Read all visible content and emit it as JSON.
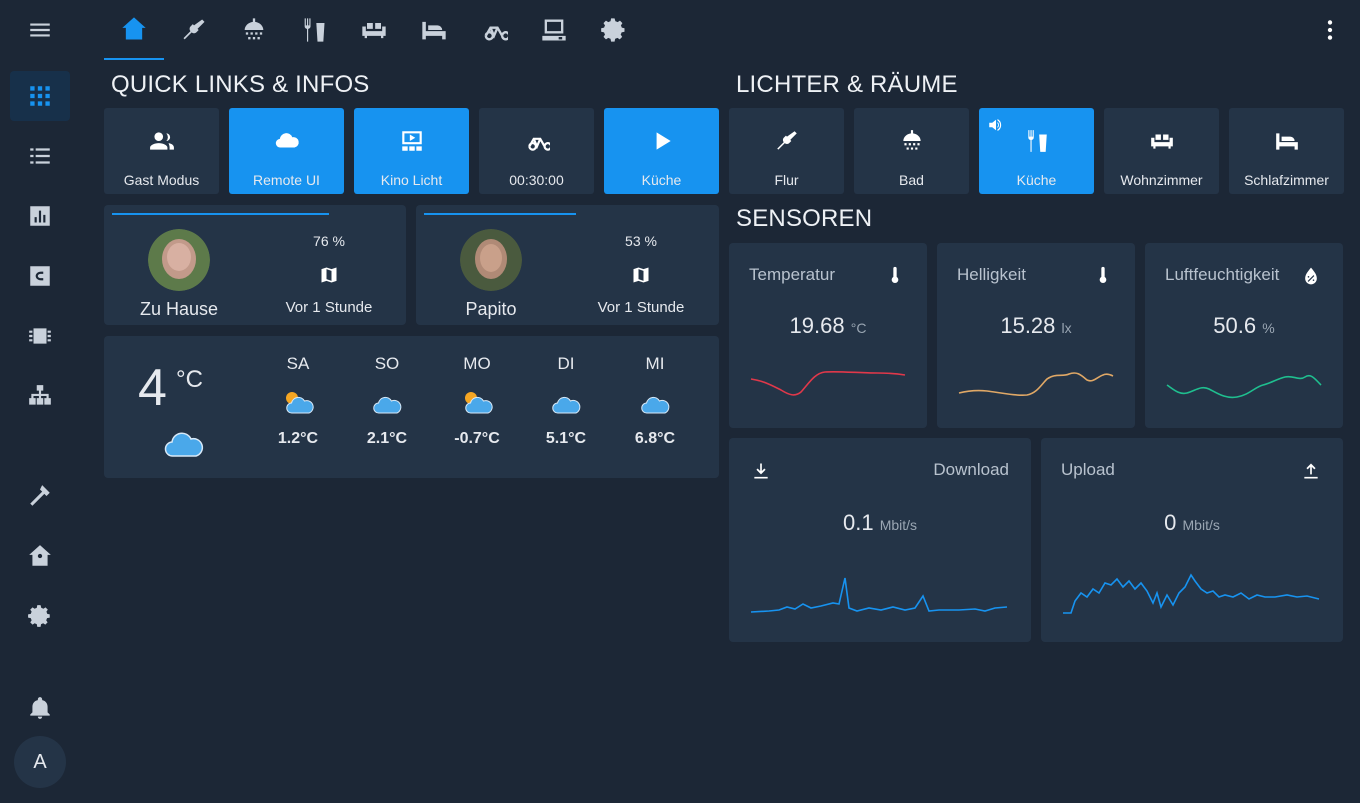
{
  "sidebar": {
    "items": [
      {
        "icon": "grid-icon"
      },
      {
        "icon": "list-icon"
      },
      {
        "icon": "chart-icon"
      },
      {
        "icon": "c-box-icon"
      },
      {
        "icon": "chip-icon"
      },
      {
        "icon": "network-icon"
      },
      {
        "icon": "hammer-icon"
      },
      {
        "icon": "home-assistant-icon"
      },
      {
        "icon": "gear-icon"
      },
      {
        "icon": "bell-icon"
      }
    ],
    "user_initial": "A"
  },
  "tabs": [
    {
      "icon": "home-icon"
    },
    {
      "icon": "broom-icon"
    },
    {
      "icon": "shower-icon"
    },
    {
      "icon": "silverware-icon"
    },
    {
      "icon": "sofa-icon"
    },
    {
      "icon": "bed-icon"
    },
    {
      "icon": "bicycle-icon"
    },
    {
      "icon": "desktop-icon"
    },
    {
      "icon": "gear-icon"
    }
  ],
  "quick_links": {
    "title": "QUICK LINKS & INFOS",
    "buttons": [
      {
        "label": "Gast Modus",
        "icon": "account-group-icon",
        "state": "off"
      },
      {
        "label": "Remote UI",
        "icon": "cloud-icon",
        "state": "on"
      },
      {
        "label": "Kino Licht",
        "icon": "theater-icon",
        "state": "on"
      },
      {
        "label": "00:30:00",
        "icon": "bicycle-icon",
        "state": "off"
      },
      {
        "label": "Küche",
        "icon": "play-icon",
        "state": "on"
      }
    ]
  },
  "persons": [
    {
      "name": "Zu Hause",
      "battery": "76 %",
      "since": "Vor 1 Stunde",
      "battery_level": 0.76
    },
    {
      "name": "Papito",
      "battery": "53 %",
      "since": "Vor 1 Stunde",
      "battery_level": 0.53
    }
  ],
  "weather": {
    "current_temp": "4",
    "unit": "°C",
    "forecast": [
      {
        "day": "SA",
        "temp": "1.2°C",
        "icon": "partly-sunny-icon"
      },
      {
        "day": "SO",
        "temp": "2.1°C",
        "icon": "cloudy-icon"
      },
      {
        "day": "MO",
        "temp": "-0.7°C",
        "icon": "partly-sunny-icon"
      },
      {
        "day": "DI",
        "temp": "5.1°C",
        "icon": "cloudy-icon"
      },
      {
        "day": "MI",
        "temp": "6.8°C",
        "icon": "cloudy-icon"
      }
    ]
  },
  "lights": {
    "title": "LICHTER & RÄUME",
    "buttons": [
      {
        "label": "Flur",
        "icon": "broom-icon",
        "state": "off"
      },
      {
        "label": "Bad",
        "icon": "shower-icon",
        "state": "off"
      },
      {
        "label": "Küche",
        "icon": "silverware-icon",
        "state": "on"
      },
      {
        "label": "Wohnzimmer",
        "icon": "sofa-icon",
        "state": "off"
      },
      {
        "label": "Schlafzimmer",
        "icon": "bed-icon",
        "state": "off"
      }
    ]
  },
  "sensors": {
    "title": "SENSOREN",
    "items": [
      {
        "name": "Temperatur",
        "value": "19.68",
        "unit": "°C",
        "icon": "thermometer-icon",
        "color": "#e0384a"
      },
      {
        "name": "Helligkeit",
        "value": "15.28",
        "unit": "lx",
        "icon": "thermometer-icon",
        "color": "#e0a866"
      },
      {
        "name": "Luftfeuchtigkeit",
        "value": "50.6",
        "unit": "%",
        "icon": "water-percent-icon",
        "color": "#1fbf8f"
      }
    ],
    "network": [
      {
        "name": "Download",
        "value": "0.1",
        "unit": "Mbit/s",
        "icon": "download-icon",
        "color": "#1793f0"
      },
      {
        "name": "Upload",
        "value": "0",
        "unit": "Mbit/s",
        "icon": "upload-icon",
        "color": "#1793f0"
      }
    ]
  },
  "colors": {
    "accent": "#1793f0",
    "background": "#1c2736",
    "card": "#243447"
  }
}
